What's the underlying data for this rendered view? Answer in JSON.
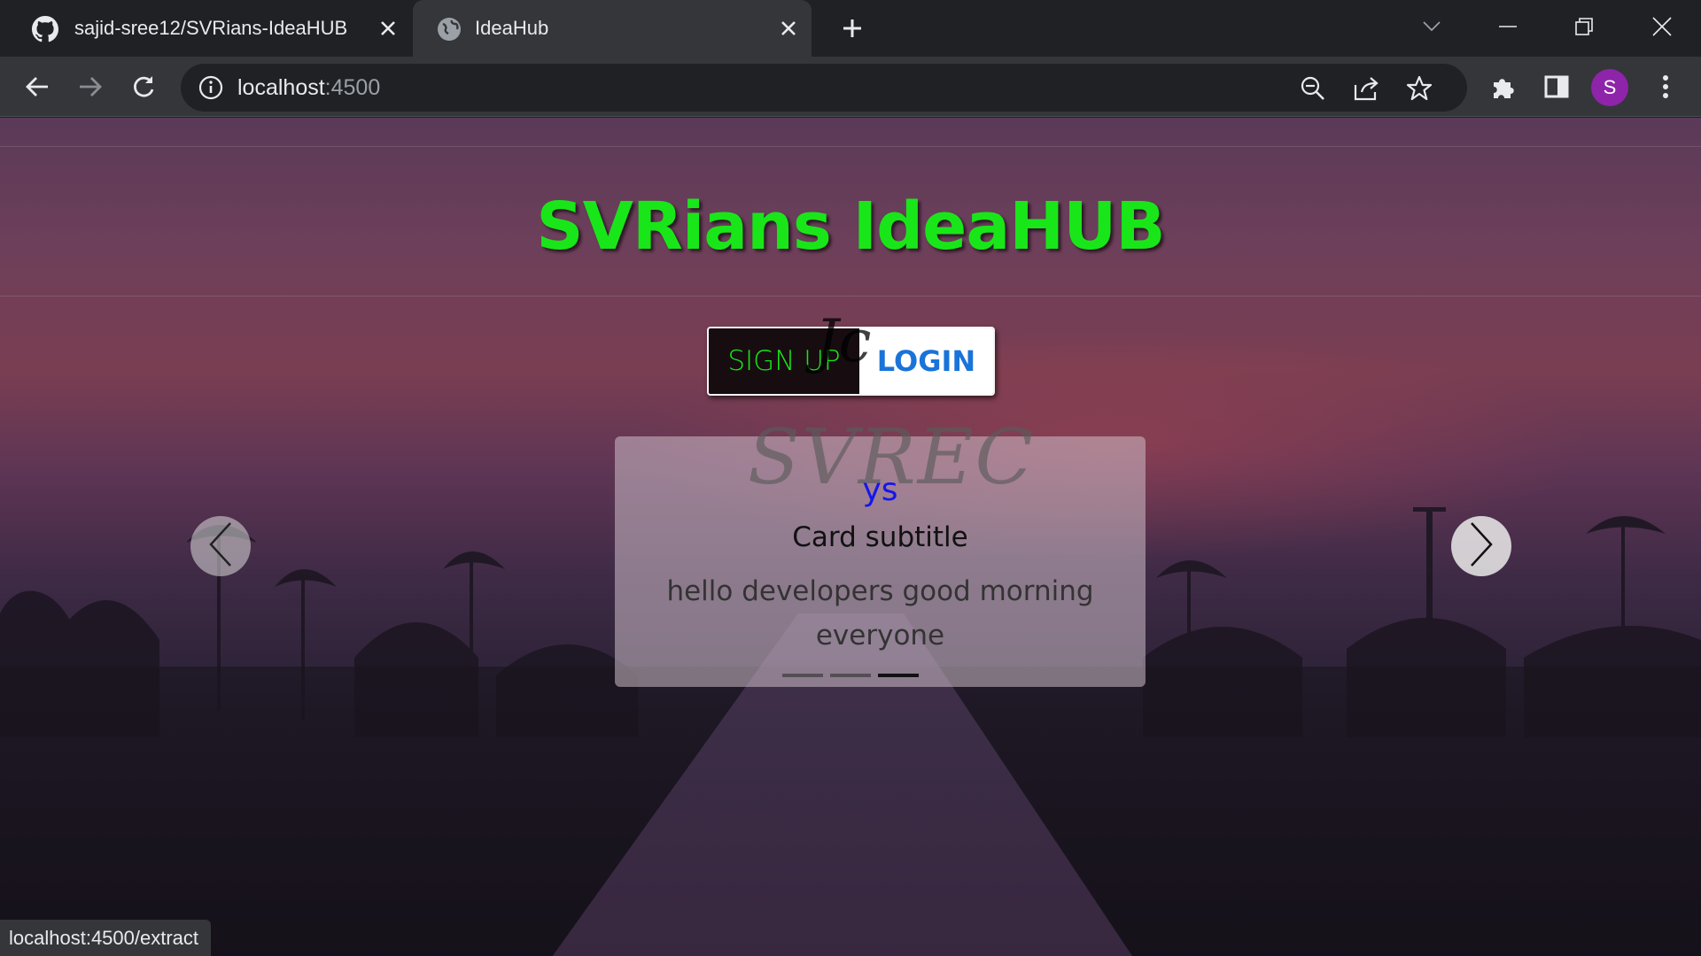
{
  "browser": {
    "tabs": [
      {
        "title": "sajid-sree12/SVRians-IdeaHUB",
        "icon": "github-icon",
        "active": false
      },
      {
        "title": "IdeaHub",
        "icon": "globe-icon",
        "active": true
      }
    ],
    "url_host": "localhost",
    "url_port": ":4500",
    "profile_initial": "S",
    "profile_color": "#8e24aa",
    "status_url": "localhost:4500/extract"
  },
  "page": {
    "site_title": "SVRians IdeaHUB",
    "title_color": "#19e619",
    "signup_label": "SIGN UP",
    "login_label": "LOGIN",
    "login_color": "#1a73d9",
    "signature_glyph": "Jc",
    "card": {
      "watermark": "SVREC",
      "title": "ys",
      "subtitle": "Card subtitle",
      "text": "hello developers good morning everyone",
      "slide_count": 3,
      "active_slide": 3
    }
  }
}
